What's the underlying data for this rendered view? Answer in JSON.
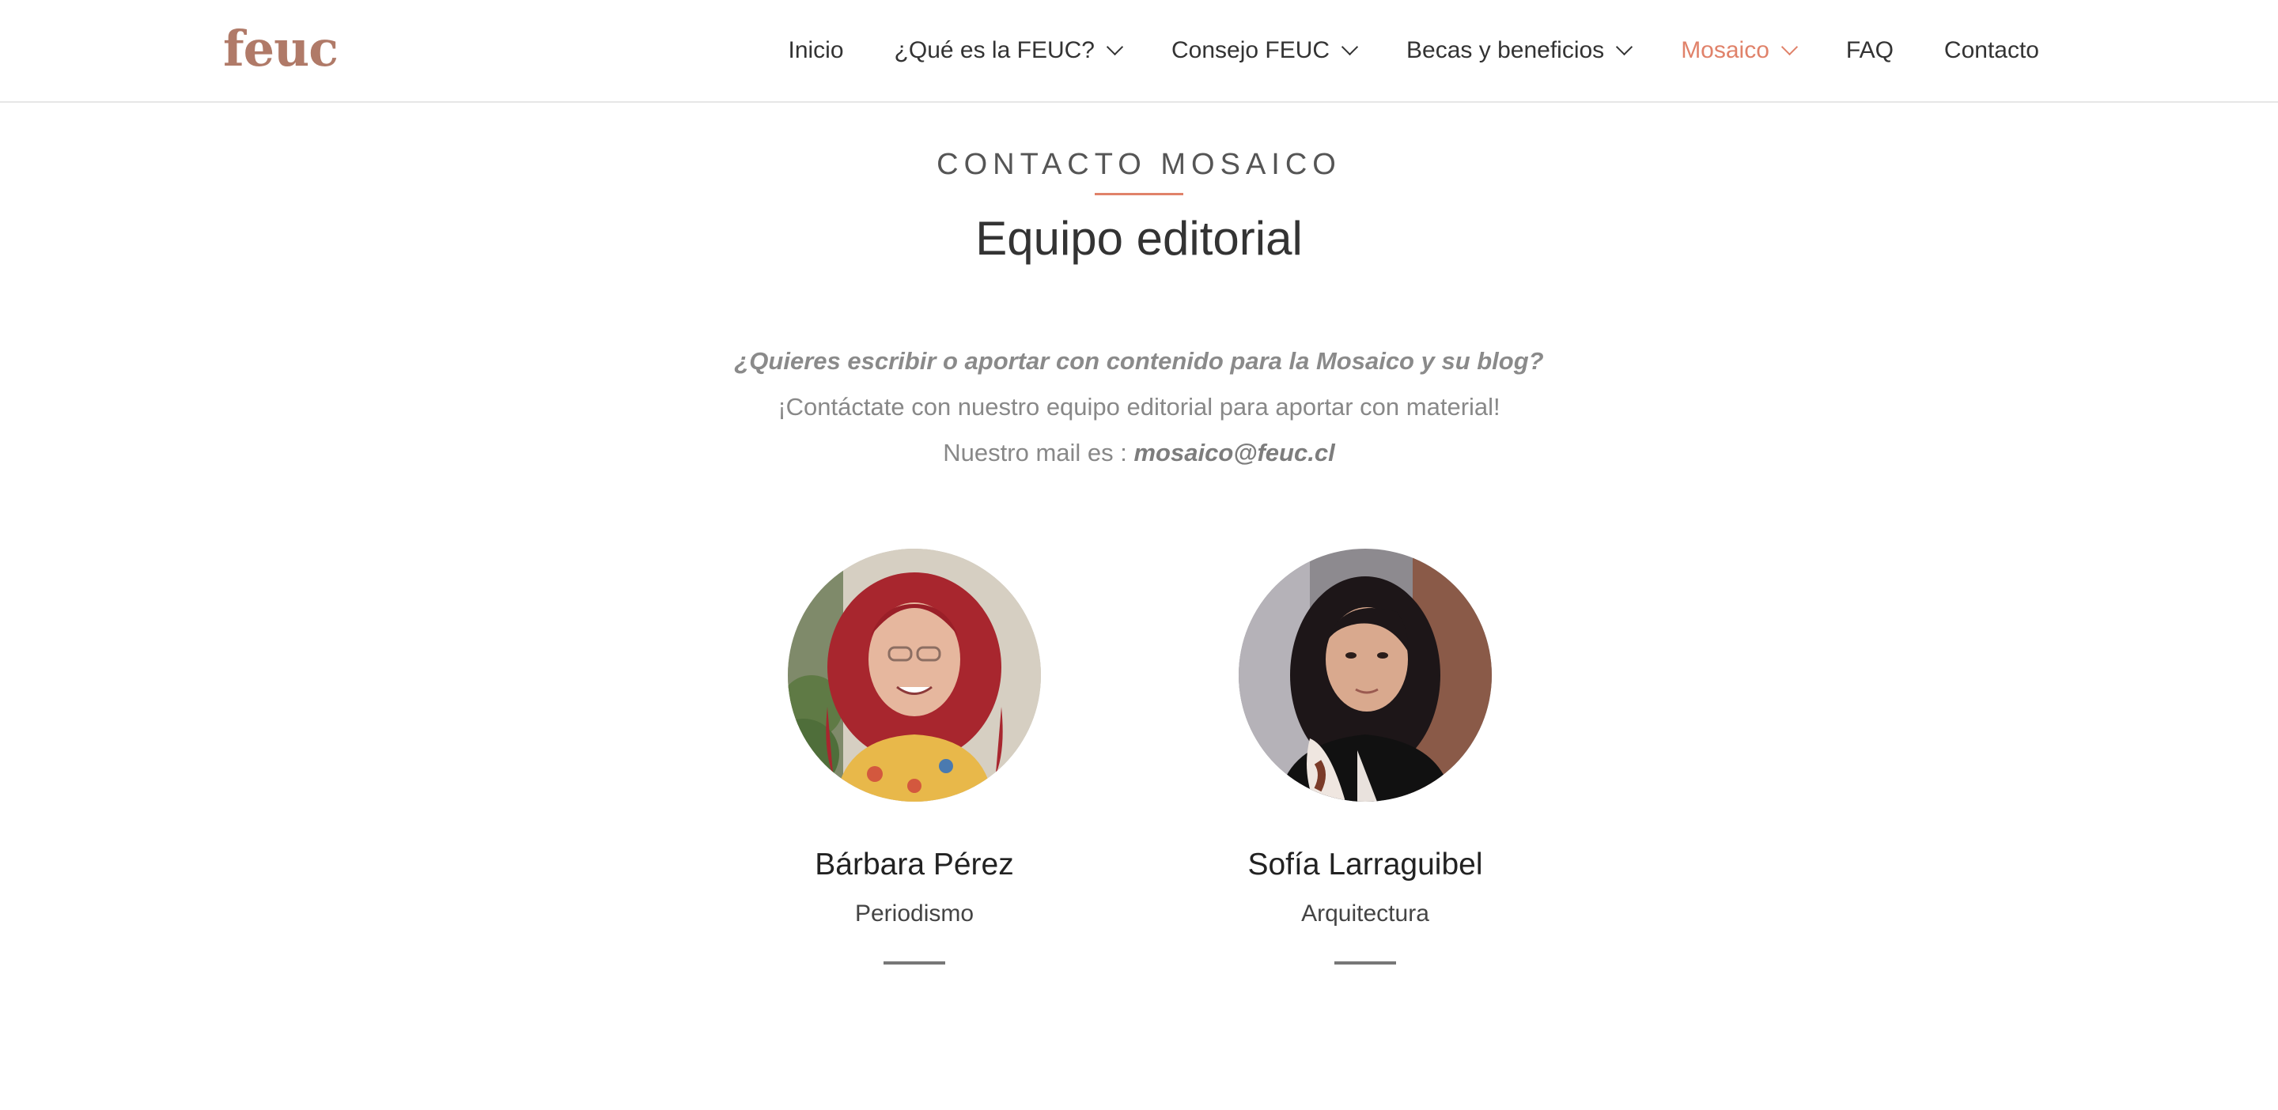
{
  "header": {
    "logo": "feuc",
    "nav": [
      {
        "label": "Inicio",
        "dropdown": false,
        "active": false
      },
      {
        "label": "¿Qué es la FEUC?",
        "dropdown": true,
        "active": false
      },
      {
        "label": "Consejo FEUC",
        "dropdown": true,
        "active": false
      },
      {
        "label": "Becas y beneficios",
        "dropdown": true,
        "active": false
      },
      {
        "label": "Mosaico",
        "dropdown": true,
        "active": true
      },
      {
        "label": "FAQ",
        "dropdown": false,
        "active": false
      },
      {
        "label": "Contacto",
        "dropdown": false,
        "active": false
      }
    ]
  },
  "section": {
    "kicker": "CONTACTO MOSAICO",
    "title": "Equipo editorial",
    "question": "¿Quieres escribir o aportar con contenido para la Mosaico y su blog?",
    "contact_line": "¡Contáctate con nuestro equipo editorial para aportar con material!",
    "mail_prefix": "Nuestro mail es : ",
    "mail": "mosaico@feuc.cl"
  },
  "team": [
    {
      "name": "Bárbara Pérez",
      "career": "Periodismo"
    },
    {
      "name": "Sofía Larraguibel",
      "career": "Arquitectura"
    }
  ],
  "colors": {
    "accent": "#e0826a",
    "logo": "#b07a68",
    "text": "#333333",
    "muted": "#888888"
  }
}
